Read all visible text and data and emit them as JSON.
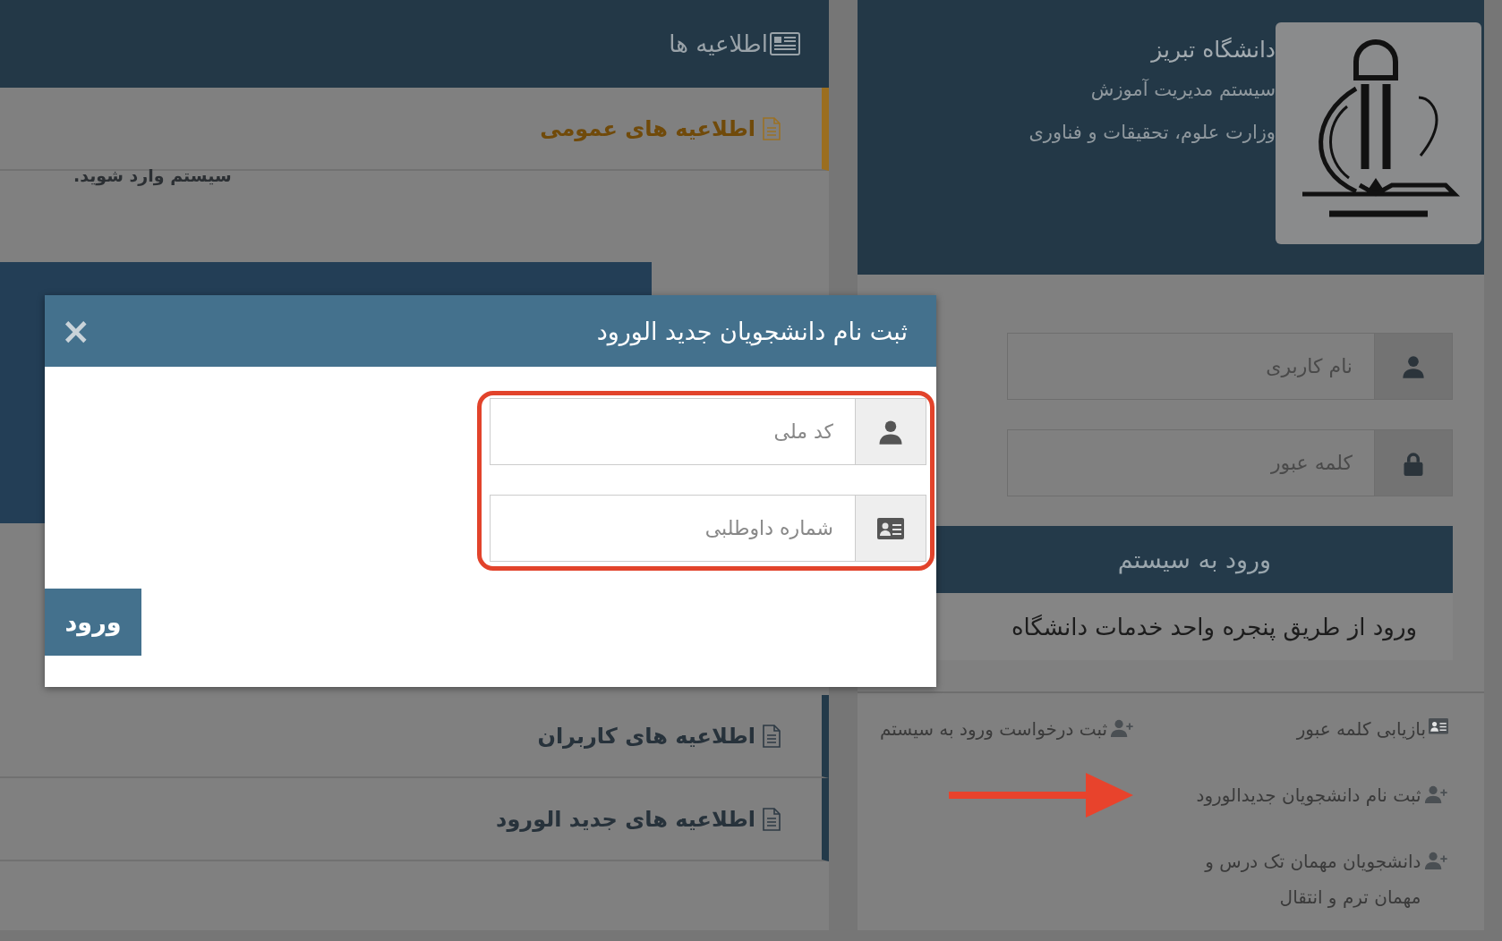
{
  "announcements": {
    "title": "اطلاعیه ها",
    "sections": [
      {
        "title": "اطلاعیه های عمومی",
        "expanded": true,
        "body": "سیستم وارد شوید."
      },
      {
        "title": "اطلاعیه های کاربران",
        "expanded": false
      },
      {
        "title": "اطلاعیه های جدید الورود",
        "expanded": false
      }
    ]
  },
  "login": {
    "university": "دانشگاه تبریز",
    "system": "سیستم مدیریت آموزش",
    "ministry": "وزارت علوم، تحقیقات و فناوری",
    "fields": [
      {
        "kind": "user",
        "placeholder": "نام کاربری"
      },
      {
        "kind": "lock",
        "placeholder": "کلمه عبور"
      }
    ],
    "submit": "ورود به سیستم",
    "sso": "ورود از طریق پنجره واحد خدمات دانشگاه",
    "links": [
      {
        "kind": "card",
        "lines": [
          "بازیابی کلمه عبور"
        ]
      },
      {
        "kind": "user-plus",
        "lines": [
          "ثبت درخواست ورود به سیستم"
        ]
      },
      {
        "kind": "user-plus",
        "lines": [
          "ثبت نام دانشجویان جدیدالورود"
        ]
      },
      {
        "kind": "user-plus",
        "lines": [
          "دانشجویان مهمان تک درس و",
          "مهمان ترم و انتقال"
        ]
      }
    ]
  },
  "dialog": {
    "title": "ثبت نام دانشجویان جدید الورود",
    "close": "×",
    "fields": [
      {
        "kind": "user",
        "placeholder": "کد ملی"
      },
      {
        "kind": "card",
        "placeholder": "شماره داوطلبی"
      }
    ],
    "submit": "ورود"
  }
}
